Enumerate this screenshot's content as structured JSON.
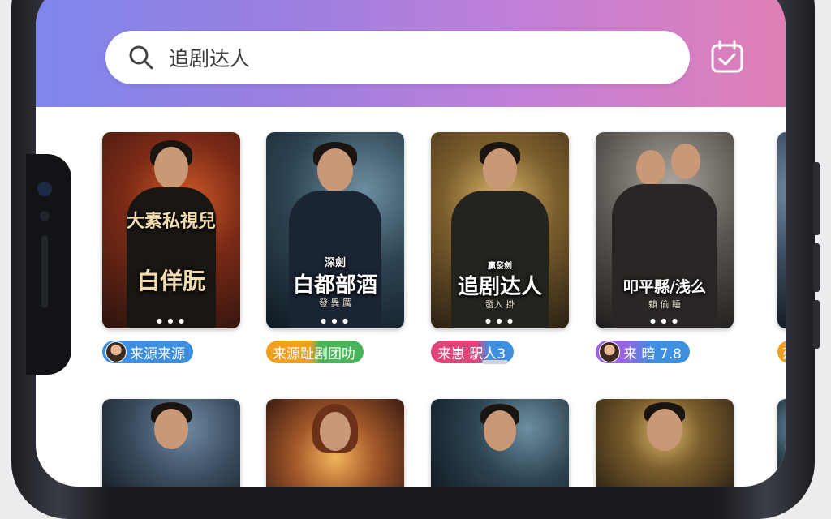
{
  "search": {
    "placeholder": "追剧达人"
  },
  "icons": {
    "search": "search-icon",
    "calendar": "calendar-check-icon"
  },
  "colors": {
    "header_start": "#7f86ec",
    "header_end": "#e07fb6",
    "tag_blue": "#3f8fe0",
    "tag_orange": "#f0a020",
    "tag_green": "#49b35a",
    "tag_pink": "#e0457a"
  },
  "row1": [
    {
      "title_top": "大素私視兒",
      "title": "白佯朊",
      "sub": "",
      "tag": "来源来源",
      "tag_avatar": true
    },
    {
      "title_top": "深劍",
      "title": "白都部酒",
      "sub": "發 異 厲",
      "tag": "来源趾剧团叻",
      "tag_avatar": false
    },
    {
      "title_top": "贏發劍",
      "title": "追剧达人",
      "sub": "發入 掛",
      "tag": "来崽 駅人3",
      "tag_avatar": false
    },
    {
      "title_top": "",
      "title": "叩平縣/浅么",
      "sub": "賴 偷 睡",
      "tag": "来 暗 7.8",
      "tag_avatar": true
    },
    {
      "title_top": "",
      "title": "",
      "sub": "",
      "tag": "茲",
      "tag_avatar": false
    }
  ]
}
